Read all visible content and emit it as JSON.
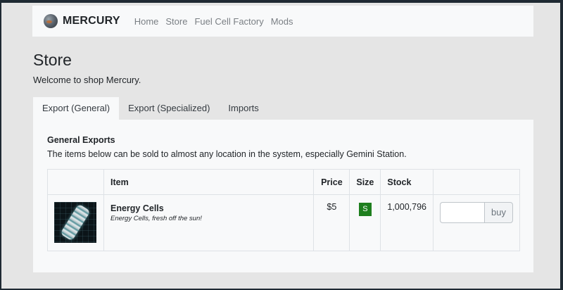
{
  "navbar": {
    "brand": "MERCURY",
    "links": [
      "Home",
      "Store",
      "Fuel Cell Factory",
      "Mods"
    ]
  },
  "page": {
    "title": "Store",
    "subtitle": "Welcome to shop Mercury."
  },
  "tabs": [
    {
      "label": "Export (General)",
      "active": true
    },
    {
      "label": "Export (Specialized)",
      "active": false
    },
    {
      "label": "Imports",
      "active": false
    }
  ],
  "panel": {
    "title": "General Exports",
    "description": "The items below can be sold to almost any location in the system, especially Gemini Station."
  },
  "table": {
    "headers": [
      "",
      "Item",
      "Price",
      "Size",
      "Stock",
      ""
    ],
    "rows": [
      {
        "icon": "energy-cell-icon",
        "name": "Energy Cells",
        "description": "Energy Cells, fresh off the sun!",
        "price": "$5",
        "size": "S",
        "stock": "1,000,796",
        "quantity_value": "",
        "buy_label": "buy"
      }
    ]
  },
  "colors": {
    "size_badge": "#1e7e1e",
    "panel_bg": "#f8f9fa",
    "page_bg": "#e5e5e5"
  }
}
